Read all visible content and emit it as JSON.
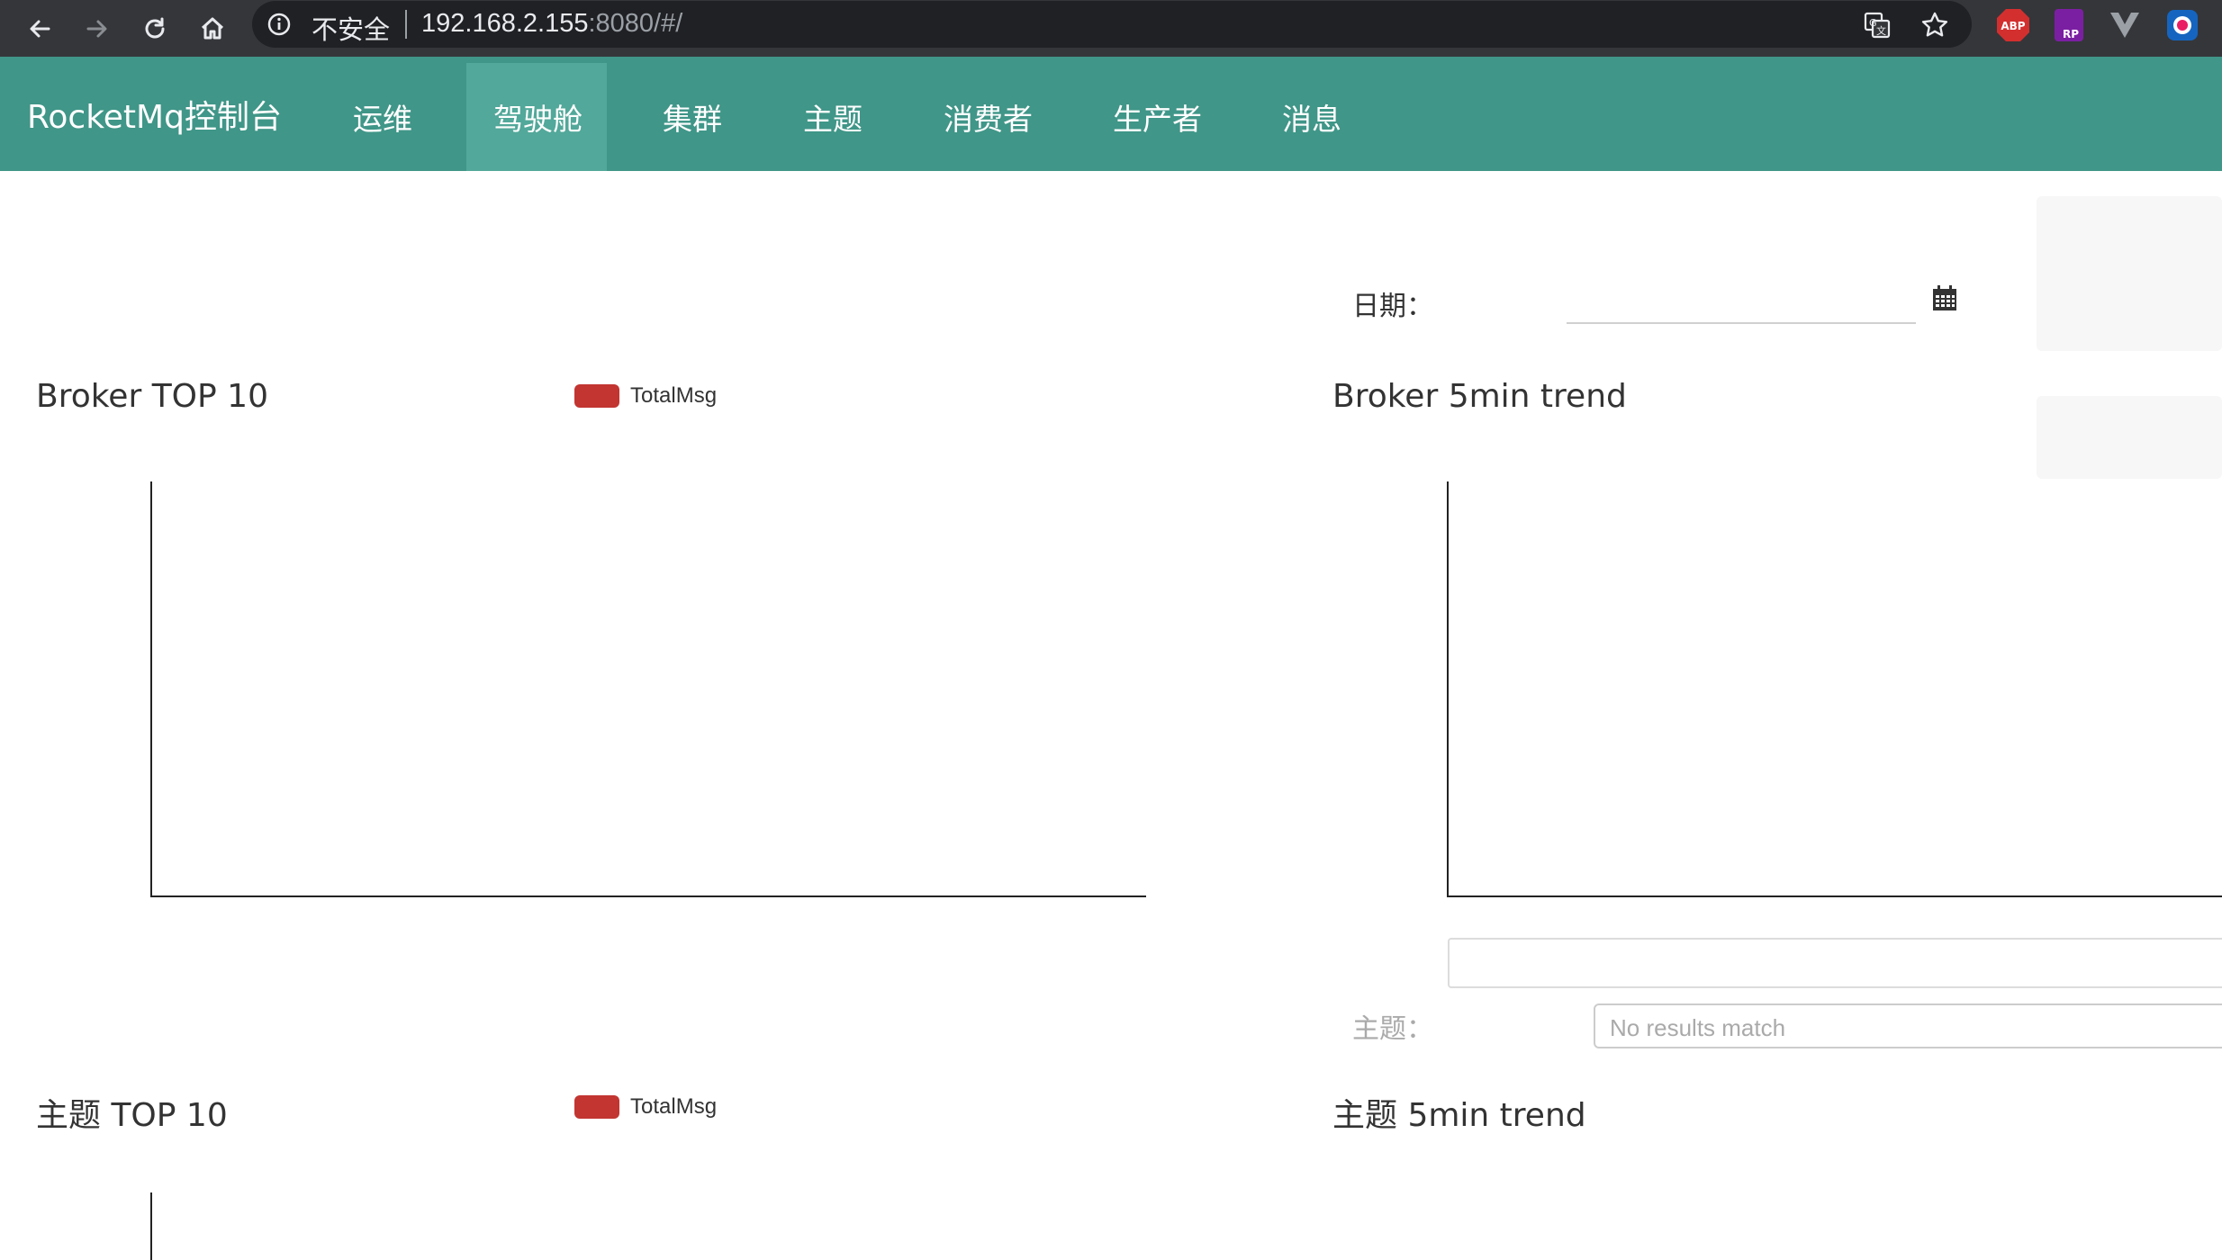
{
  "browser": {
    "security_text": "不安全",
    "url_host": "192.168.2.155",
    "url_rest": ":8080/#/",
    "icons": [
      "back-icon",
      "forward-icon",
      "reload-icon",
      "home-icon",
      "info-icon",
      "translate-icon",
      "star-icon"
    ],
    "extensions": [
      {
        "name": "adblock-plus",
        "label": "ABP",
        "color": "#d32f2f"
      },
      {
        "name": "rp-extension",
        "label": "RP",
        "color": "#7b1fa2"
      },
      {
        "name": "vue-devtools",
        "label": "",
        "color": "#9aa0a6"
      },
      {
        "name": "profile-extension",
        "label": "",
        "color": "#1565c0"
      }
    ]
  },
  "navbar": {
    "brand": "RocketMq控制台",
    "background": "#409688",
    "active_background": "#52a89a",
    "items": [
      {
        "label": "运维",
        "active": false
      },
      {
        "label": "驾驶舱",
        "active": true
      },
      {
        "label": "集群",
        "active": false
      },
      {
        "label": "主题",
        "active": false
      },
      {
        "label": "消费者",
        "active": false
      },
      {
        "label": "生产者",
        "active": false
      },
      {
        "label": "消息",
        "active": false
      }
    ]
  },
  "filters": {
    "date_label": "日期：",
    "date_value": "",
    "topic_label": "主题：",
    "topic_search_text": "No results match"
  },
  "charts": {
    "broker_top10": {
      "title": "Broker TOP 10",
      "legend": "TotalMsg",
      "legend_color": "#c23531"
    },
    "broker_trend": {
      "title": "Broker 5min trend"
    },
    "topic_top10": {
      "title": "主题 TOP 10",
      "legend": "TotalMsg",
      "legend_color": "#c23531"
    },
    "topic_trend": {
      "title": "主题 5min trend"
    }
  },
  "chart_data": [
    {
      "type": "bar",
      "title": "Broker TOP 10",
      "series": [
        {
          "name": "TotalMsg",
          "values": []
        }
      ],
      "categories": []
    },
    {
      "type": "line",
      "title": "Broker 5min trend",
      "series": []
    },
    {
      "type": "bar",
      "title": "主题 TOP 10",
      "series": [
        {
          "name": "TotalMsg",
          "values": []
        }
      ],
      "categories": []
    },
    {
      "type": "line",
      "title": "主题 5min trend",
      "series": []
    }
  ]
}
